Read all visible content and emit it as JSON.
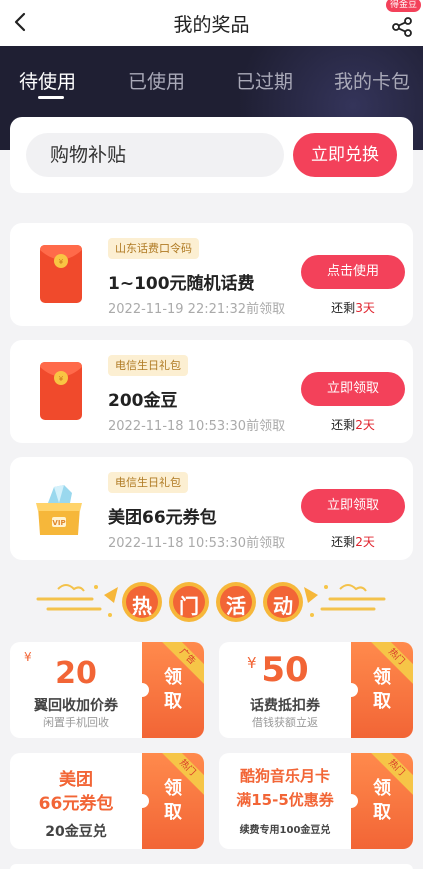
{
  "header": {
    "title": "我的奖品",
    "share_badge": "得金豆"
  },
  "tabs": [
    {
      "label": "待使用",
      "active": true
    },
    {
      "label": "已使用",
      "active": false
    },
    {
      "label": "已过期",
      "active": false
    },
    {
      "label": "我的卡包",
      "active": false
    }
  ],
  "redeem": {
    "input_value": "购物补贴",
    "button_label": "立即兑换"
  },
  "prizes": [
    {
      "tag": "山东话费口令码",
      "name": "1~100元随机话费",
      "date": "2022-11-19 22:21:32前领取",
      "button": "点击使用",
      "remain_prefix": "还剩",
      "remain_days": "3天",
      "icon": "red-envelope-icon"
    },
    {
      "tag": "电信生日礼包",
      "name": "200金豆",
      "date": "2022-11-18 10:53:30前领取",
      "button": "立即领取",
      "remain_prefix": "还剩",
      "remain_days": "2天",
      "icon": "red-envelope-icon"
    },
    {
      "tag": "电信生日礼包",
      "name": "美团66元券包",
      "date": "2022-11-18 10:53:30前领取",
      "button": "立即领取",
      "remain_prefix": "还剩",
      "remain_days": "2天",
      "icon": "vip-treasure-box-icon"
    }
  ],
  "section_banner": {
    "chars": [
      "热",
      "门",
      "活",
      "动"
    ]
  },
  "activities": [
    {
      "currency": "¥",
      "amount": "20",
      "title": "翼回收加价券",
      "subtitle": "闲置手机回收",
      "side_label": [
        "领",
        "取"
      ],
      "corner": "广告"
    },
    {
      "currency": "¥",
      "amount": "50",
      "title": "话费抵扣券",
      "subtitle": "借钱获额立返",
      "side_label": [
        "领",
        "取"
      ],
      "corner": "热门"
    },
    {
      "line1": "美团",
      "line2": "66元券包",
      "footer": "20金豆兑",
      "side_label": [
        "领",
        "取"
      ],
      "corner": "热门"
    },
    {
      "line1": "酷狗音乐月卡",
      "line2": "满15-5优惠券",
      "footer": "续费专用100金豆兑",
      "side_label": [
        "领",
        "取"
      ],
      "corner": "热门"
    }
  ],
  "colors": {
    "accent": "#f3415a",
    "band": "#1f1f33",
    "activity_orange": "#f26536",
    "tag_bg": "#fcefd2"
  }
}
